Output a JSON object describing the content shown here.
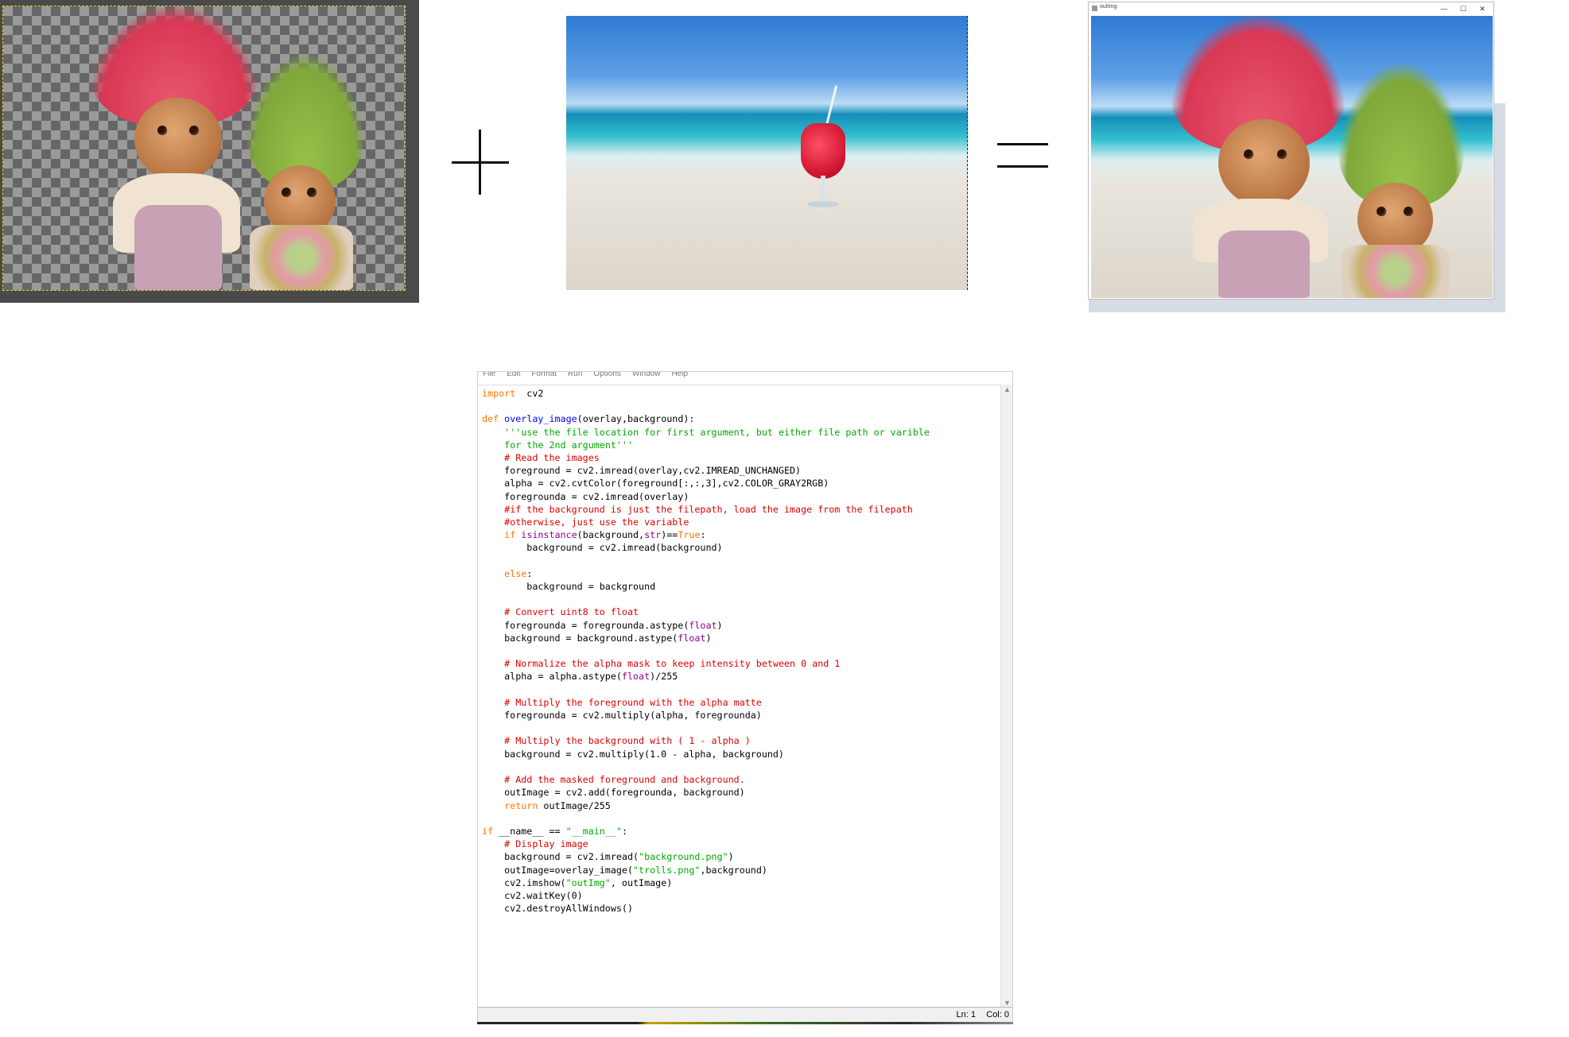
{
  "colors": {
    "keyword": "#ff7700",
    "builtin": "#900090",
    "function_name": "#0000ff",
    "string": "#00aa00",
    "comment": "#dd0000",
    "checkerboard_dark": "#666666",
    "checkerboard_light": "#9a9a9a"
  },
  "composition": {
    "overlay_panel_icon": "transparent-checkerboard",
    "plus_icon": "plus-icon",
    "equals_icon": "equals-icon"
  },
  "output_window": {
    "title": "outImg",
    "minimize": "—",
    "maximize": "☐",
    "close": "✕"
  },
  "editor": {
    "menu": [
      "File",
      "Edit",
      "Format",
      "Run",
      "Options",
      "Window",
      "Help"
    ],
    "status": {
      "line": "Ln: 1",
      "col": "Col: 0"
    },
    "scroll_up": "▲",
    "scroll_down": "▼",
    "code": [
      [
        [
          "kw",
          "import"
        ],
        [
          "",
          "  cv2"
        ]
      ],
      [],
      [
        [
          "kw",
          "def"
        ],
        [
          "",
          " "
        ],
        [
          "fn",
          "overlay_image"
        ],
        [
          "",
          "(overlay,background):"
        ]
      ],
      [
        [
          "",
          "    "
        ],
        [
          "st",
          "'''use the file location for first argument, but either file path or varible"
        ]
      ],
      [
        [
          "",
          "    "
        ],
        [
          "st",
          "for the 2nd argument'''"
        ]
      ],
      [
        [
          "",
          "    "
        ],
        [
          "cm",
          "# Read the images"
        ]
      ],
      [
        [
          "",
          "    foreground = cv2.imread(overlay,cv2.IMREAD_UNCHANGED)"
        ]
      ],
      [
        [
          "",
          "    alpha = cv2.cvtColor(foreground[:,:,3],cv2.COLOR_GRAY2RGB)"
        ]
      ],
      [
        [
          "",
          "    foregrounda = cv2.imread(overlay)"
        ]
      ],
      [
        [
          "",
          "    "
        ],
        [
          "cm",
          "#if the background is just the filepath, load the image from the filepath"
        ]
      ],
      [
        [
          "",
          "    "
        ],
        [
          "cm",
          "#otherwise, just use the variable"
        ]
      ],
      [
        [
          "",
          "    "
        ],
        [
          "kw",
          "if"
        ],
        [
          "",
          " "
        ],
        [
          "bi",
          "isinstance"
        ],
        [
          "",
          "(background,"
        ],
        [
          "bi",
          "str"
        ],
        [
          "",
          ")=="
        ],
        [
          "kw",
          "True"
        ],
        [
          "",
          ":"
        ]
      ],
      [
        [
          "",
          "        background = cv2.imread(background)"
        ]
      ],
      [],
      [
        [
          "",
          "    "
        ],
        [
          "kw",
          "else"
        ],
        [
          "",
          ":"
        ]
      ],
      [
        [
          "",
          "        background = background"
        ]
      ],
      [],
      [
        [
          "",
          "    "
        ],
        [
          "cm",
          "# Convert uint8 to float"
        ]
      ],
      [
        [
          "",
          "    foregrounda = foregrounda.astype("
        ],
        [
          "bi",
          "float"
        ],
        [
          "",
          ")"
        ]
      ],
      [
        [
          "",
          "    background = background.astype("
        ],
        [
          "bi",
          "float"
        ],
        [
          "",
          ")"
        ]
      ],
      [],
      [
        [
          "",
          "    "
        ],
        [
          "cm",
          "# Normalize the alpha mask to keep intensity between 0 and 1"
        ]
      ],
      [
        [
          "",
          "    alpha = alpha.astype("
        ],
        [
          "bi",
          "float"
        ],
        [
          "",
          ")/255"
        ]
      ],
      [],
      [
        [
          "",
          "    "
        ],
        [
          "cm",
          "# Multiply the foreground with the alpha matte"
        ]
      ],
      [
        [
          "",
          "    foregrounda = cv2.multiply(alpha, foregrounda)"
        ]
      ],
      [],
      [
        [
          "",
          "    "
        ],
        [
          "cm",
          "# Multiply the background with ( 1 - alpha )"
        ]
      ],
      [
        [
          "",
          "    background = cv2.multiply(1.0 - alpha, background)"
        ]
      ],
      [],
      [
        [
          "",
          "    "
        ],
        [
          "cm",
          "# Add the masked foreground and background."
        ]
      ],
      [
        [
          "",
          "    outImage = cv2.add(foregrounda, background)"
        ]
      ],
      [
        [
          "",
          "    "
        ],
        [
          "kw",
          "return"
        ],
        [
          "",
          " outImage/255"
        ]
      ],
      [],
      [
        [
          "kw",
          "if"
        ],
        [
          "",
          " __name__ == "
        ],
        [
          "st",
          "\"__main__\""
        ],
        [
          "",
          ":"
        ]
      ],
      [
        [
          "",
          "    "
        ],
        [
          "cm",
          "# Display image"
        ]
      ],
      [
        [
          "",
          "    background = cv2.imread("
        ],
        [
          "st",
          "\"background.png\""
        ],
        [
          "",
          ")"
        ]
      ],
      [
        [
          "",
          "    outImage=overlay_image("
        ],
        [
          "st",
          "\"trolls.png\""
        ],
        [
          "",
          ",background)"
        ]
      ],
      [
        [
          "",
          "    cv2.imshow("
        ],
        [
          "st",
          "\"outImg\""
        ],
        [
          "",
          ", outImage)"
        ]
      ],
      [
        [
          "",
          "    cv2.waitKey(0)"
        ]
      ],
      [
        [
          "",
          "    cv2.destroyAllWindows()"
        ]
      ]
    ]
  }
}
